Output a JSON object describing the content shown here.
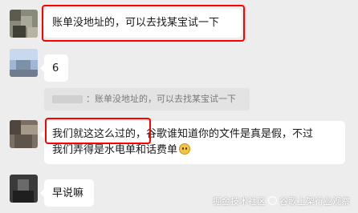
{
  "colors": {
    "background": "#ededed",
    "bubble": "#ffffff",
    "highlight_box": "#ff0000",
    "quote_bg": "#e3e3e3"
  },
  "messages": [
    {
      "text": "账单没地址的，可以去找某宝试一下"
    },
    {
      "text": "6"
    },
    {
      "quote": "：账单没地址的，可以去找某宝试一下"
    },
    {
      "line1": "我们就这这么过的，谷歌谁知道你的文件是真是假，不过",
      "line2": "我们弄得是水电单和话费单",
      "emoji": "cat-emoji-icon"
    },
    {
      "text": "早说嘛"
    }
  ],
  "watermark": {
    "left": "掘金技术社区",
    "right": "谷歌上架行业观察"
  }
}
